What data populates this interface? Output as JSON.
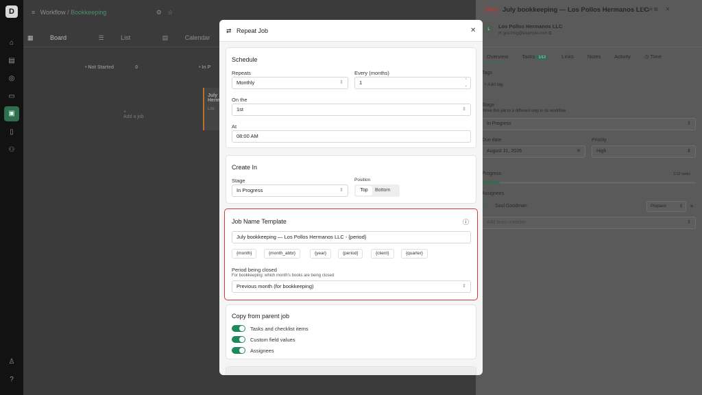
{
  "app": {
    "logo": "D"
  },
  "rail": {
    "icons": [
      "home-icon",
      "building-icon",
      "circle-icon",
      "document-icon",
      "briefcase-icon",
      "file-icon",
      "users-icon"
    ],
    "bottom_icons": [
      "person-icon",
      "help-icon"
    ]
  },
  "breadcrumb": {
    "root": "Workflow",
    "sep": "/",
    "current": "Bookkeeping"
  },
  "board_tabs": [
    {
      "label": "Board"
    },
    {
      "label": "List"
    },
    {
      "label": "Calendar"
    }
  ],
  "columns": {
    "not_started": {
      "name": "Not Started",
      "count": "0",
      "add": "Add a job"
    },
    "in_progress": {
      "name": "In P"
    }
  },
  "card": {
    "title1": "July",
    "title2": "Herma",
    "sub": "Los"
  },
  "right": {
    "badge": "WEEK",
    "title": "July bookkeeping — Los Pollos Hermanos LLC",
    "client": "Los Pollos Hermanos LLC",
    "email": "gus.fring@example.com",
    "avatar": "L",
    "tabs": [
      {
        "label": "Overview"
      },
      {
        "label": "Tasks"
      },
      {
        "label": "Links"
      },
      {
        "label": "Notes"
      },
      {
        "label": "Activity"
      },
      {
        "label": "Time"
      }
    ],
    "tasks_badge": "1/12",
    "tags": "Tags",
    "add_tag": "+ Add tag",
    "stage_label": "Stage",
    "stage_help": "Move this job to a different step in its workflow",
    "stage": "In Progress",
    "due_label": "Due date",
    "due": "August 31, 2026",
    "priority_label": "Priority",
    "priority": "High",
    "progress_label": "Progress",
    "progress_value": "1/12 tasks",
    "progress_fraction": 0.083,
    "assignees_label": "Assignees",
    "assignee_initials": "SG",
    "assignee": "Saul Goodman",
    "role": "Preparer",
    "add_member": "Add team member"
  },
  "modal": {
    "title": "Repeat Job",
    "schedule": {
      "heading": "Schedule",
      "repeats_label": "Repeats",
      "repeats": "Monthly",
      "every_label": "Every (months)",
      "every": "1",
      "on_label": "On the",
      "on": "1st",
      "at_label": "At",
      "at": "08:00 AM"
    },
    "create_in": {
      "heading": "Create In",
      "stage_label": "Stage",
      "stage": "In Progress",
      "position_label": "Position",
      "top": "Top",
      "bottom": "Bottom"
    },
    "template": {
      "heading": "Job Name Template",
      "value": "July bookkeeping — Los Pollos Hermanos LLC - {period}",
      "chips": [
        "{month}",
        "{month_abbr}",
        "{year}",
        "{period}",
        "{client}",
        "{quarter}"
      ],
      "period_label": "Period being closed",
      "period_help": "For bookkeeping: which month's books are being closed",
      "period": "Previous month (for bookkeeping)"
    },
    "copy": {
      "heading": "Copy from parent job",
      "items": [
        "Tasks and checklist items",
        "Custom field values",
        "Assignees"
      ]
    }
  },
  "colors": {
    "accent": "#1f8a5b",
    "highlight": "#d0393e"
  }
}
